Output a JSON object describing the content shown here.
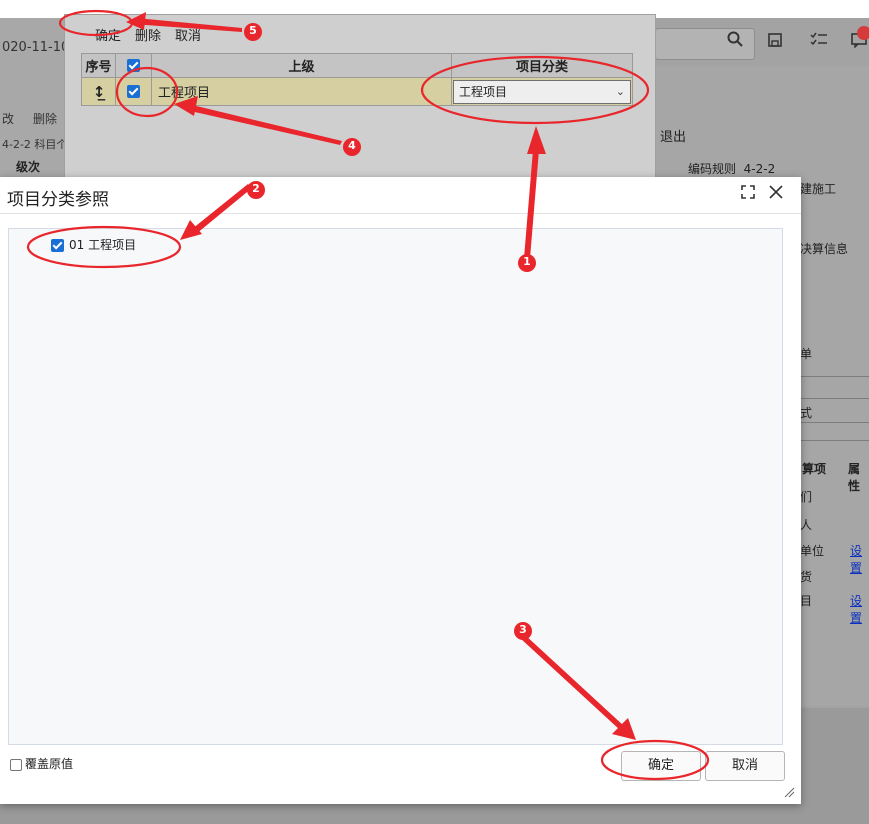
{
  "background": {
    "date_fragment": "020-11-10",
    "tool_modify": "改",
    "tool_delete": "删除",
    "rule_small": "4-2-2  科目个",
    "level_header": "级次",
    "exit": "退出",
    "rule_label": "编码规则",
    "rule_value": "4-2-2",
    "right_fragments": [
      "建施工",
      "决算信息",
      "单",
      "式"
    ],
    "grid_headers": [
      "算项",
      "属性"
    ],
    "grid_rows": [
      "们",
      "人",
      "单位",
      "货",
      "目"
    ],
    "grid_links": [
      "设置",
      "设置"
    ]
  },
  "upper_dialog": {
    "toolbar": {
      "confirm": "确定",
      "delete": "删除",
      "cancel": "取消"
    },
    "columns": {
      "seq": "序号",
      "parent": "上级",
      "category": "项目分类"
    },
    "row": {
      "seq_icon": "move-icon",
      "parent": "工程项目",
      "category": "工程项目"
    }
  },
  "modal": {
    "title": "项目分类参照",
    "tree": [
      {
        "code": "01",
        "label": "01 工程项目",
        "checked": true
      }
    ],
    "override_label": "覆盖原值",
    "confirm_button": "确定",
    "cancel_button": "取消"
  },
  "annotations": {
    "color": "#e8262b",
    "steps": [
      "1",
      "2",
      "3",
      "4",
      "5"
    ]
  }
}
